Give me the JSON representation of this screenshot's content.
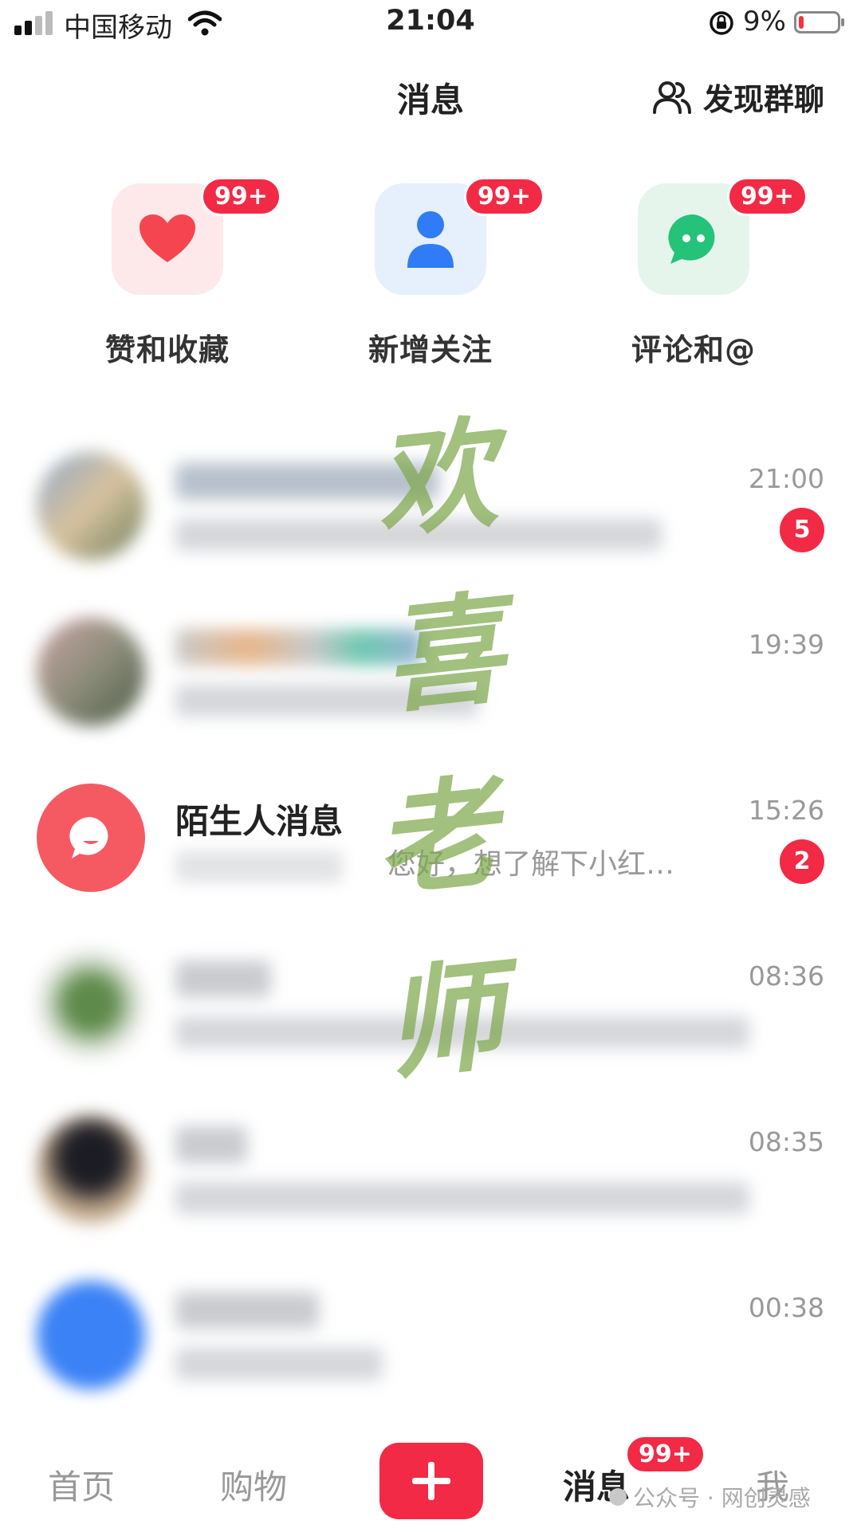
{
  "status_bar": {
    "carrier": "中国移动",
    "time": "21:04",
    "battery_percent": "9%",
    "battery_level": 0.09
  },
  "header": {
    "title": "消息",
    "group_chat_label": "发现群聊"
  },
  "entries": [
    {
      "label": "赞和收藏",
      "badge": "99+",
      "icon": "heart-icon",
      "color": "#f5454f"
    },
    {
      "label": "新增关注",
      "badge": "99+",
      "icon": "person-icon",
      "color": "#2f7cf6"
    },
    {
      "label": "评论和@",
      "badge": "99+",
      "icon": "chat-bubble-icon",
      "color": "#25c27a"
    }
  ],
  "conversations": [
    {
      "time": "21:00",
      "unread": "5",
      "blurred": true
    },
    {
      "time": "19:39",
      "unread": "",
      "blurred": true
    },
    {
      "name": "陌生人消息",
      "preview": "您好，想了解下小红…",
      "time": "15:26",
      "unread": "2",
      "blurred": false
    },
    {
      "time": "08:36",
      "unread": "",
      "blurred": true
    },
    {
      "time": "08:35",
      "unread": "",
      "blurred": true
    },
    {
      "time": "00:38",
      "unread": "",
      "blurred": true
    }
  ],
  "watermark": [
    "欢",
    "喜",
    "老",
    "师"
  ],
  "tab_bar": {
    "home": "首页",
    "shop": "购物",
    "messages": "消息",
    "messages_badge": "99+",
    "me": "我"
  },
  "credit": "公众号 · 网创灵感",
  "colors": {
    "accent_red": "#f22a45",
    "watermark_green": "#7ea84c"
  }
}
